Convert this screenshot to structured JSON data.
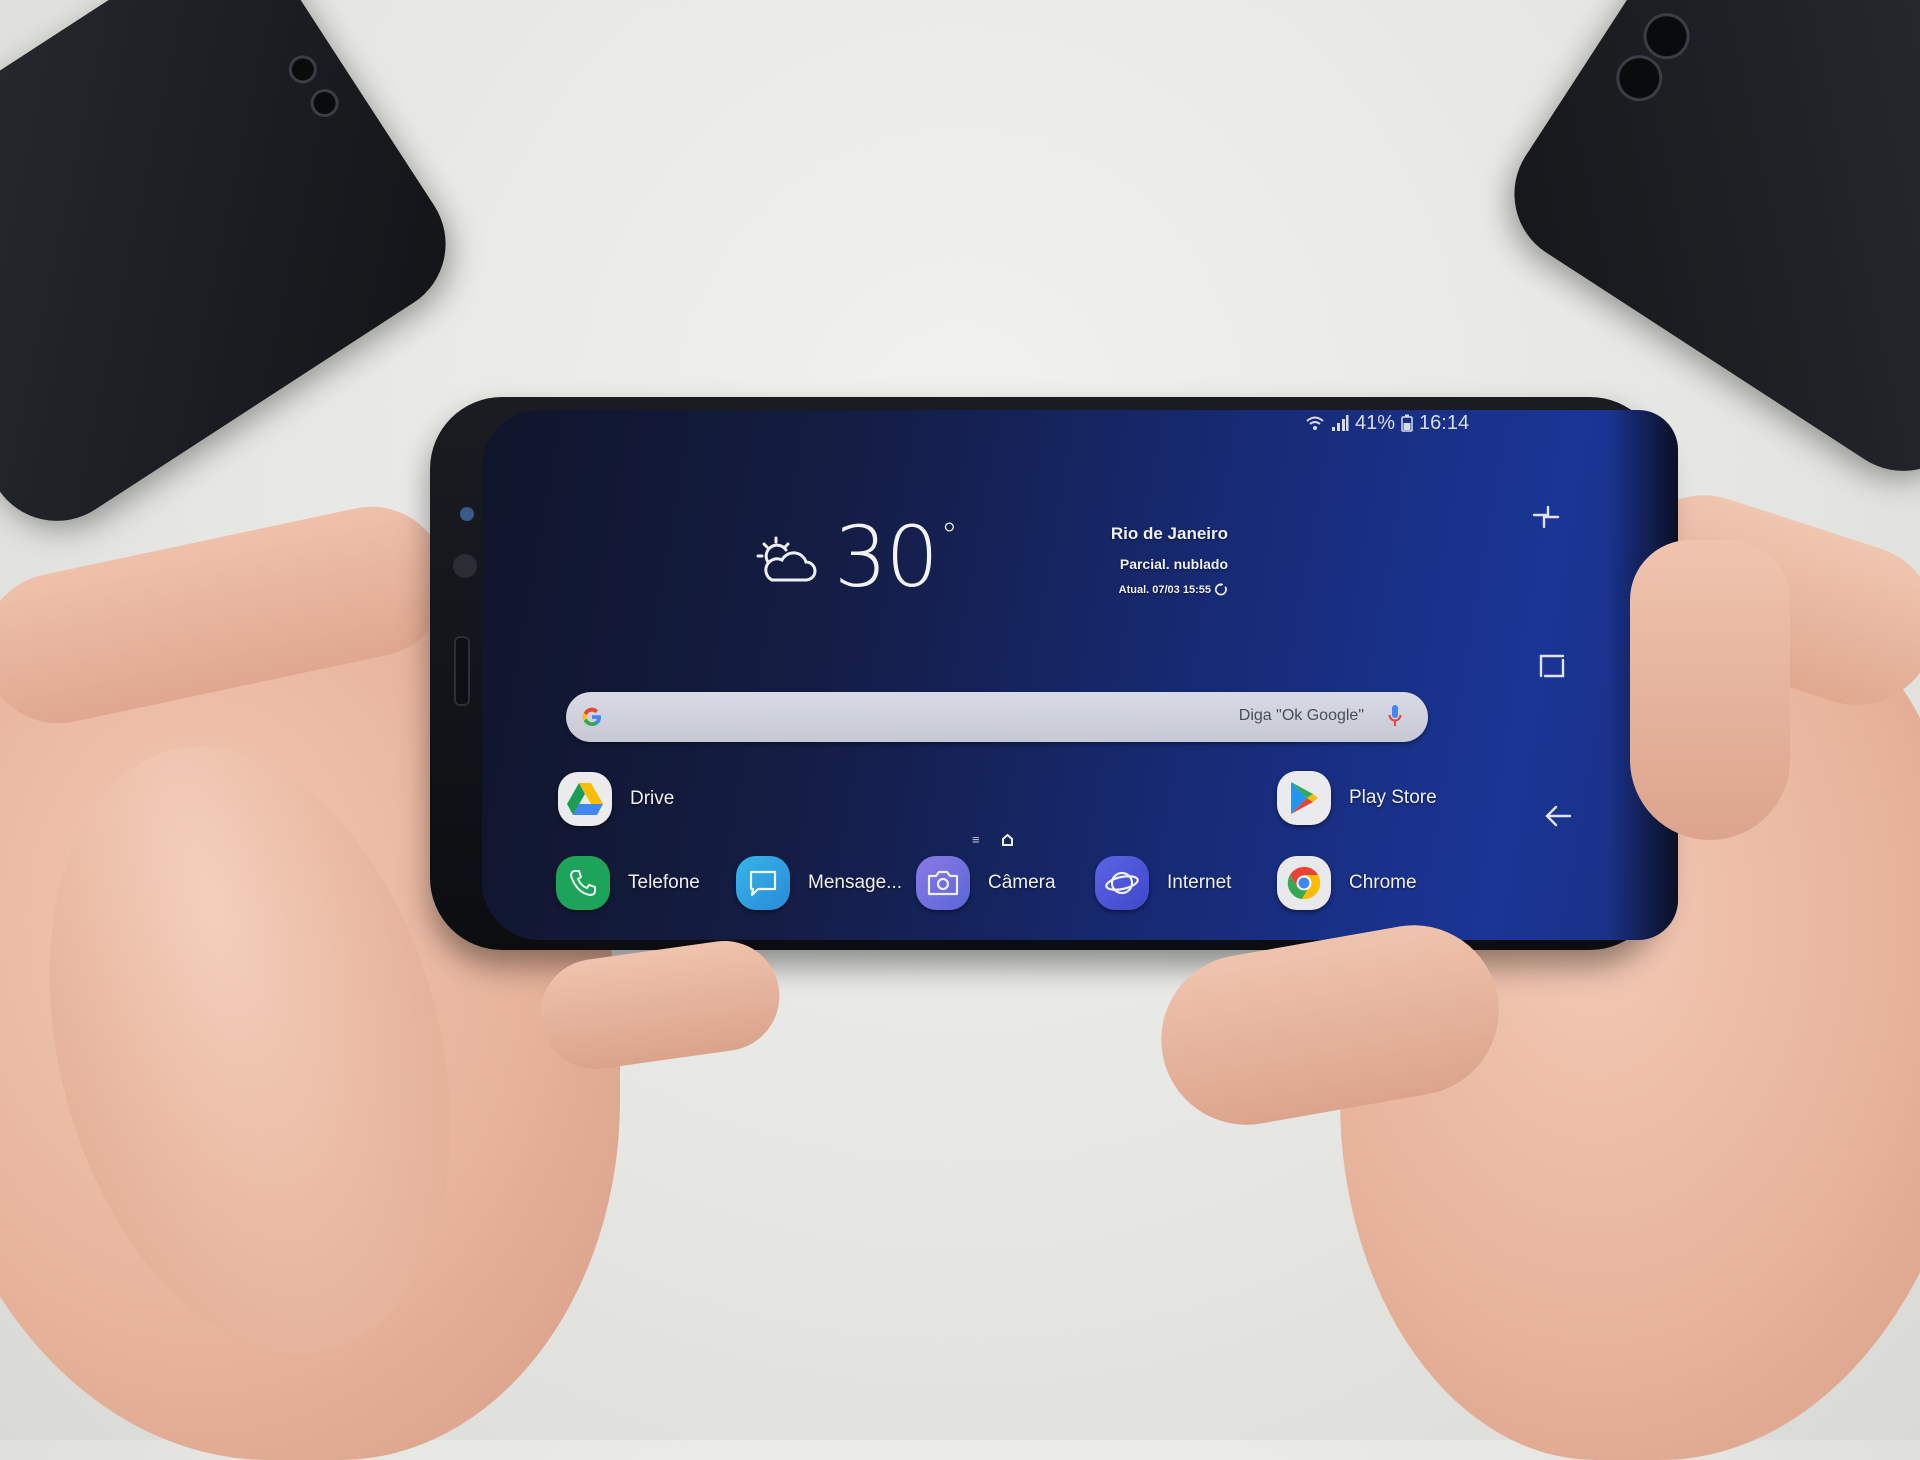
{
  "status_bar": {
    "wifi_icon": "wifi-icon",
    "signal_icon": "signal-icon",
    "battery_percent": "41%",
    "battery_icon": "battery-icon",
    "time": "16:14"
  },
  "weather": {
    "icon": "partly-cloudy-icon",
    "temperature": "30",
    "degree_symbol": "°",
    "city": "Rio de Janeiro",
    "condition": "Parcial. nublado",
    "updated": "Atual. 07/03 15:55",
    "refresh_icon": "refresh-icon"
  },
  "search": {
    "logo": "G",
    "hint": "Diga \"Ok Google\"",
    "mic_icon": "mic-icon"
  },
  "home_apps": [
    {
      "label": "Drive",
      "icon": "google-drive-icon"
    },
    {
      "label": "Play Store",
      "icon": "play-store-icon"
    }
  ],
  "page_indicator": {
    "menu_icon": "≡",
    "home_icon": "home-page-icon"
  },
  "dock_apps": [
    {
      "label": "Telefone",
      "icon": "phone-icon",
      "color": "#1ea35a"
    },
    {
      "label": "Mensage...",
      "icon": "messages-icon",
      "color": "#2a9de0"
    },
    {
      "label": "Câmera",
      "icon": "camera-icon",
      "color": "#6e6ad8"
    },
    {
      "label": "Internet",
      "icon": "internet-icon",
      "color": "#4b55d8"
    },
    {
      "label": "Chrome",
      "icon": "chrome-icon",
      "color": "#e9e9ec"
    }
  ],
  "nav_bar": {
    "recents": "recents-icon",
    "home": "home-icon",
    "back": "back-icon"
  },
  "colors": {
    "wallpaper_dark": "#10152a",
    "wallpaper_blue": "#1a3596",
    "google_blue": "#4285f4",
    "google_red": "#ea4335",
    "google_yellow": "#fbbc05",
    "google_green": "#34a853"
  }
}
